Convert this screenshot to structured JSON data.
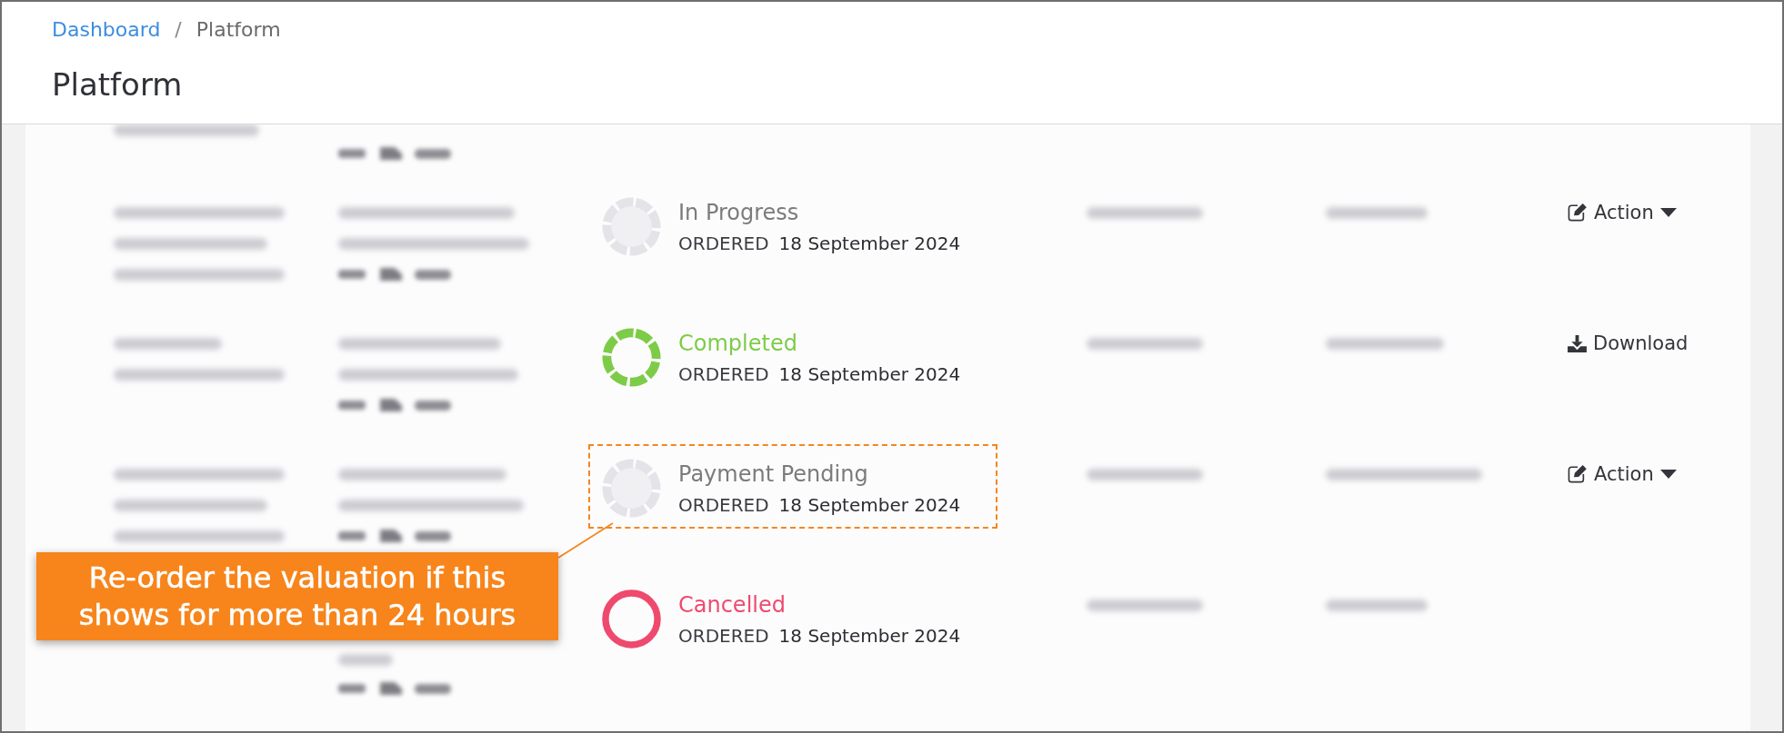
{
  "breadcrumb": {
    "items": [
      {
        "label": "Dashboard",
        "current": false
      },
      {
        "label": "Platform",
        "current": true
      }
    ],
    "separator": "/"
  },
  "page_title": "Platform",
  "orders": [
    {
      "status": {
        "kind": "in_progress",
        "label": "In Progress",
        "color": "#7b7b7b"
      },
      "ordered_label": "ORDERED",
      "ordered_date": "18 September 2024",
      "action": {
        "kind": "menu",
        "label": "Action"
      },
      "highlighted": false
    },
    {
      "status": {
        "kind": "completed",
        "label": "Completed",
        "color": "#7dcc48"
      },
      "ordered_label": "ORDERED",
      "ordered_date": "18 September 2024",
      "action": {
        "kind": "download",
        "label": "Download"
      },
      "highlighted": false
    },
    {
      "status": {
        "kind": "payment_pending",
        "label": "Payment Pending",
        "color": "#7b7b7b"
      },
      "ordered_label": "ORDERED",
      "ordered_date": "18 September 2024",
      "action": {
        "kind": "menu",
        "label": "Action"
      },
      "highlighted": true
    },
    {
      "status": {
        "kind": "cancelled",
        "label": "Cancelled",
        "color": "#ee4a6e"
      },
      "ordered_label": "ORDERED",
      "ordered_date": "18 September 2024",
      "highlighted": false
    }
  ],
  "callout": {
    "text": "Re-order the valuation if this shows for more than 24 hours"
  }
}
